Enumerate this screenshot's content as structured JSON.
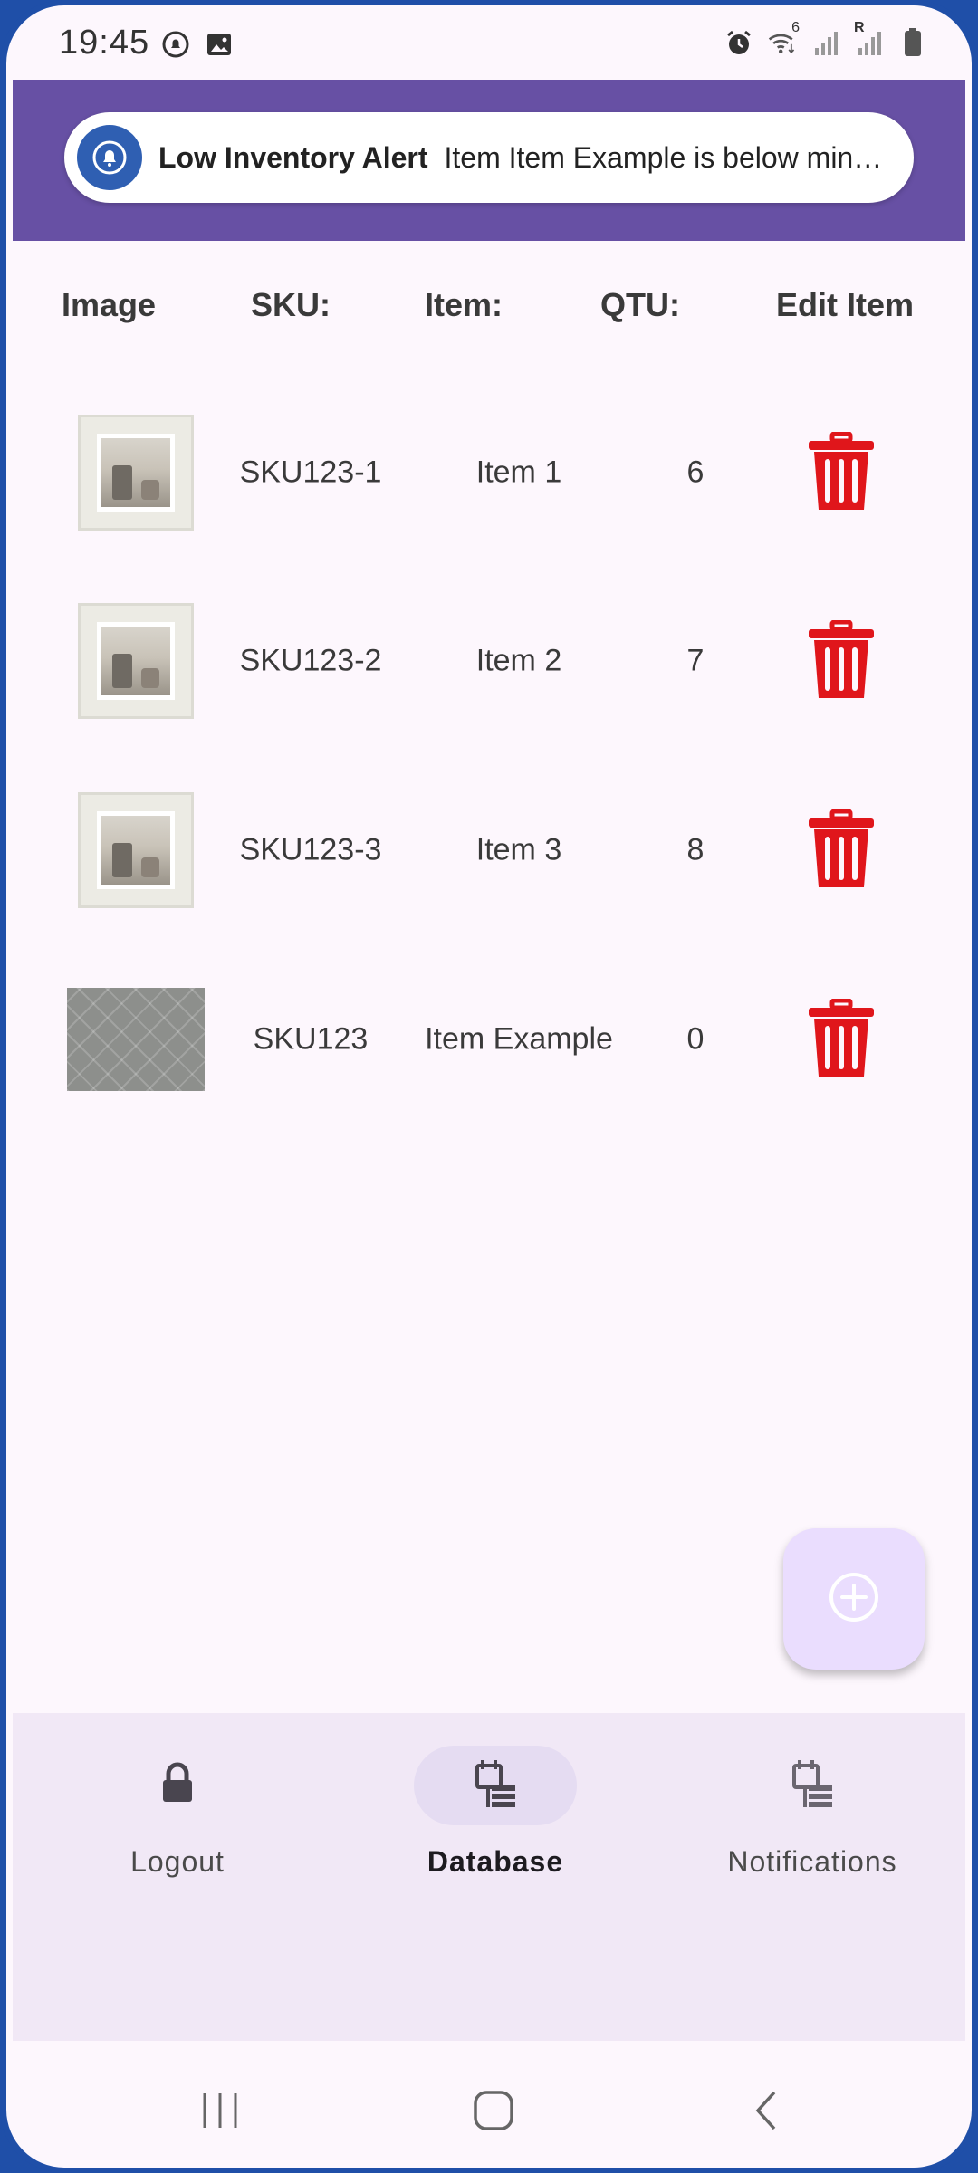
{
  "status_bar": {
    "time": "19:45",
    "left_icons": [
      "notification-bell-icon",
      "image-icon"
    ],
    "right_icons": [
      "alarm-icon",
      "wifi-icon",
      "signal-icon",
      "signal-roaming-icon",
      "battery-icon"
    ],
    "wifi_label": "6",
    "roaming_label": "R"
  },
  "notification": {
    "title": "Low Inventory Alert",
    "body": "Item Item Example is below min…"
  },
  "table": {
    "headers": [
      "Image",
      "SKU:",
      "Item:",
      "QTU:",
      "Edit Item"
    ],
    "rows": [
      {
        "sku": "SKU123-1",
        "item": "Item 1",
        "qty": "6",
        "image": "framed-photo"
      },
      {
        "sku": "SKU123-2",
        "item": "Item 2",
        "qty": "7",
        "image": "framed-photo"
      },
      {
        "sku": "SKU123-3",
        "item": "Item 3",
        "qty": "8",
        "image": "framed-photo"
      },
      {
        "sku": "SKU123",
        "item": "Item Example",
        "qty": "0",
        "image": "carpet-texture"
      }
    ]
  },
  "fab": {
    "icon": "add-circle-icon"
  },
  "bottom_nav": {
    "items": [
      {
        "label": "Logout",
        "icon": "lock-icon",
        "active": false
      },
      {
        "label": "Database",
        "icon": "database-icon",
        "active": true
      },
      {
        "label": "Notifications",
        "icon": "database-icon",
        "active": false
      }
    ]
  },
  "colors": {
    "header": "#6750a4",
    "trash": "#e0161b",
    "fab": "#eaddfe",
    "nav_bg": "#f1e8f6",
    "toast_icon": "#2f5fb2"
  }
}
